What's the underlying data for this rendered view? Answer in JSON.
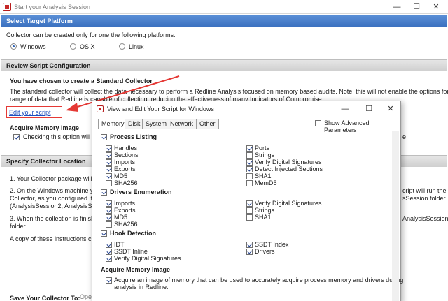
{
  "window": {
    "title": "Start your Analysis Session",
    "minimize": "—",
    "maximize": "☐",
    "close": "✕"
  },
  "target_platform": {
    "header": "Select Target Platform",
    "description": "Collector can be created only for one the following platforms:",
    "options": [
      {
        "label": "Windows",
        "selected": true
      },
      {
        "label": "OS X",
        "selected": false
      },
      {
        "label": "Linux",
        "selected": false
      }
    ]
  },
  "review": {
    "header": "Review Script Configuration",
    "heading": "You have chosen to create a Standard Collector",
    "line1": "The standard collector will collect the data necessary to perform a Redline Analysis focused on memory based audits.  Note: this will not enable the options for the full",
    "line2": "range of data that Redline is capable of collecting, reducing the effectiveness of many Indicators of Compromise.",
    "edit_link": "Edit your script",
    "acquire_title": "Acquire Memory Image",
    "acquire_text": "Checking this option will ac",
    "acquire_tail": "e"
  },
  "collector_location": {
    "header": "Specify Collector Location",
    "step1": "1. Your Collector package will b",
    "step2a": "2. On the Windows machine yo",
    "step2b": "Collector, as you configured it",
    "step2c": "(AnalysisSession2, AnalysisSessi",
    "step2_right1": "cript will run the",
    "step2_right2": "sSession folder",
    "step3a": "3. When the collection is finishe",
    "step3b": "folder.",
    "step3_right": "AnalysisSession",
    "copy_text": "A copy of these instructions ca",
    "save_label": "Save Your Collector To:",
    "save_value": "Ope"
  },
  "dialog": {
    "title": "View and Edit Your Script for Windows",
    "minimize": "—",
    "maximize": "☐",
    "close": "✕",
    "tabs": [
      "Memory",
      "Disk",
      "System",
      "Network",
      "Other"
    ],
    "show_advanced": "Show Advanced Parameters",
    "process_listing": {
      "label": "Process Listing",
      "left": [
        {
          "label": "Handles",
          "checked": true
        },
        {
          "label": "Sections",
          "checked": true
        },
        {
          "label": "Imports",
          "checked": true
        },
        {
          "label": "Exports",
          "checked": true
        },
        {
          "label": "MD5",
          "checked": true
        },
        {
          "label": "SHA256",
          "checked": false
        }
      ],
      "right": [
        {
          "label": "Ports",
          "checked": true
        },
        {
          "label": "Strings",
          "checked": false
        },
        {
          "label": "Verify Digital Signatures",
          "checked": true
        },
        {
          "label": "Detect Injected Sections",
          "checked": true
        },
        {
          "label": "SHA1",
          "checked": false
        },
        {
          "label": "MemD5",
          "checked": false
        }
      ]
    },
    "drivers_enumeration": {
      "label": "Drivers Enumeration",
      "left": [
        {
          "label": "Imports",
          "checked": true
        },
        {
          "label": "Exports",
          "checked": true
        },
        {
          "label": "MD5",
          "checked": true
        },
        {
          "label": "SHA256",
          "checked": false
        }
      ],
      "right": [
        {
          "label": "Verify Digital Signatures",
          "checked": true
        },
        {
          "label": "Strings",
          "checked": false
        },
        {
          "label": "SHA1",
          "checked": false
        }
      ]
    },
    "hook_detection": {
      "label": "Hook Detection",
      "left": [
        {
          "label": "IDT",
          "checked": true
        },
        {
          "label": "SSDT Inline",
          "checked": true
        },
        {
          "label": "Verify Digital Signatures",
          "checked": true
        }
      ],
      "right": [
        {
          "label": "SSDT Index",
          "checked": true
        },
        {
          "label": "Drivers",
          "checked": true
        }
      ]
    },
    "acquire_memory": {
      "label": "Acquire Memory Image",
      "text1": "Acquire an image of memory that can be used to accurately acquire process memory and drivers during",
      "text2": "analysis in Redline."
    }
  }
}
